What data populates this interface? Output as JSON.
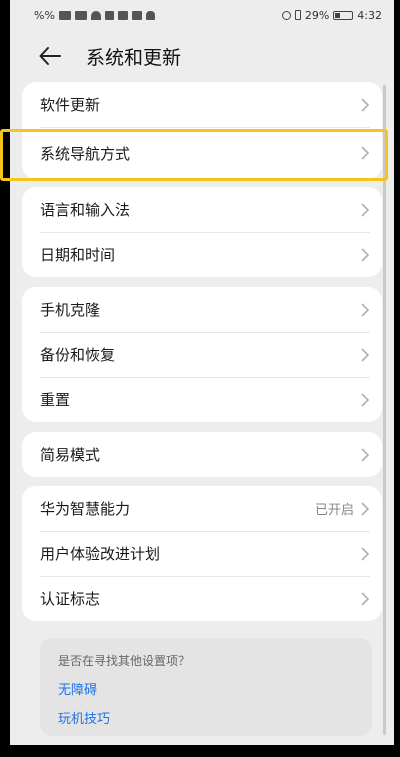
{
  "status_bar": {
    "left_text": "%%",
    "battery_percent": "29%",
    "time": "4:32"
  },
  "header": {
    "back_icon": "back-arrow-icon",
    "title": "系统和更新"
  },
  "groups": [
    {
      "items": [
        {
          "label": "软件更新"
        },
        {
          "label": "系统导航方式"
        }
      ]
    },
    {
      "items": [
        {
          "label": "语言和输入法"
        },
        {
          "label": "日期和时间"
        }
      ]
    },
    {
      "items": [
        {
          "label": "手机克隆"
        },
        {
          "label": "备份和恢复"
        },
        {
          "label": "重置"
        }
      ]
    },
    {
      "items": [
        {
          "label": "简易模式"
        }
      ]
    },
    {
      "items": [
        {
          "label": "华为智慧能力",
          "value": "已开启"
        },
        {
          "label": "用户体验改进计划"
        },
        {
          "label": "认证标志"
        }
      ]
    }
  ],
  "suggestions": {
    "question": "是否在寻找其他设置项？",
    "links": [
      "无障碍",
      "玩机技巧"
    ]
  },
  "colors": {
    "highlight": "#f5c518",
    "link": "#1a73e8"
  }
}
